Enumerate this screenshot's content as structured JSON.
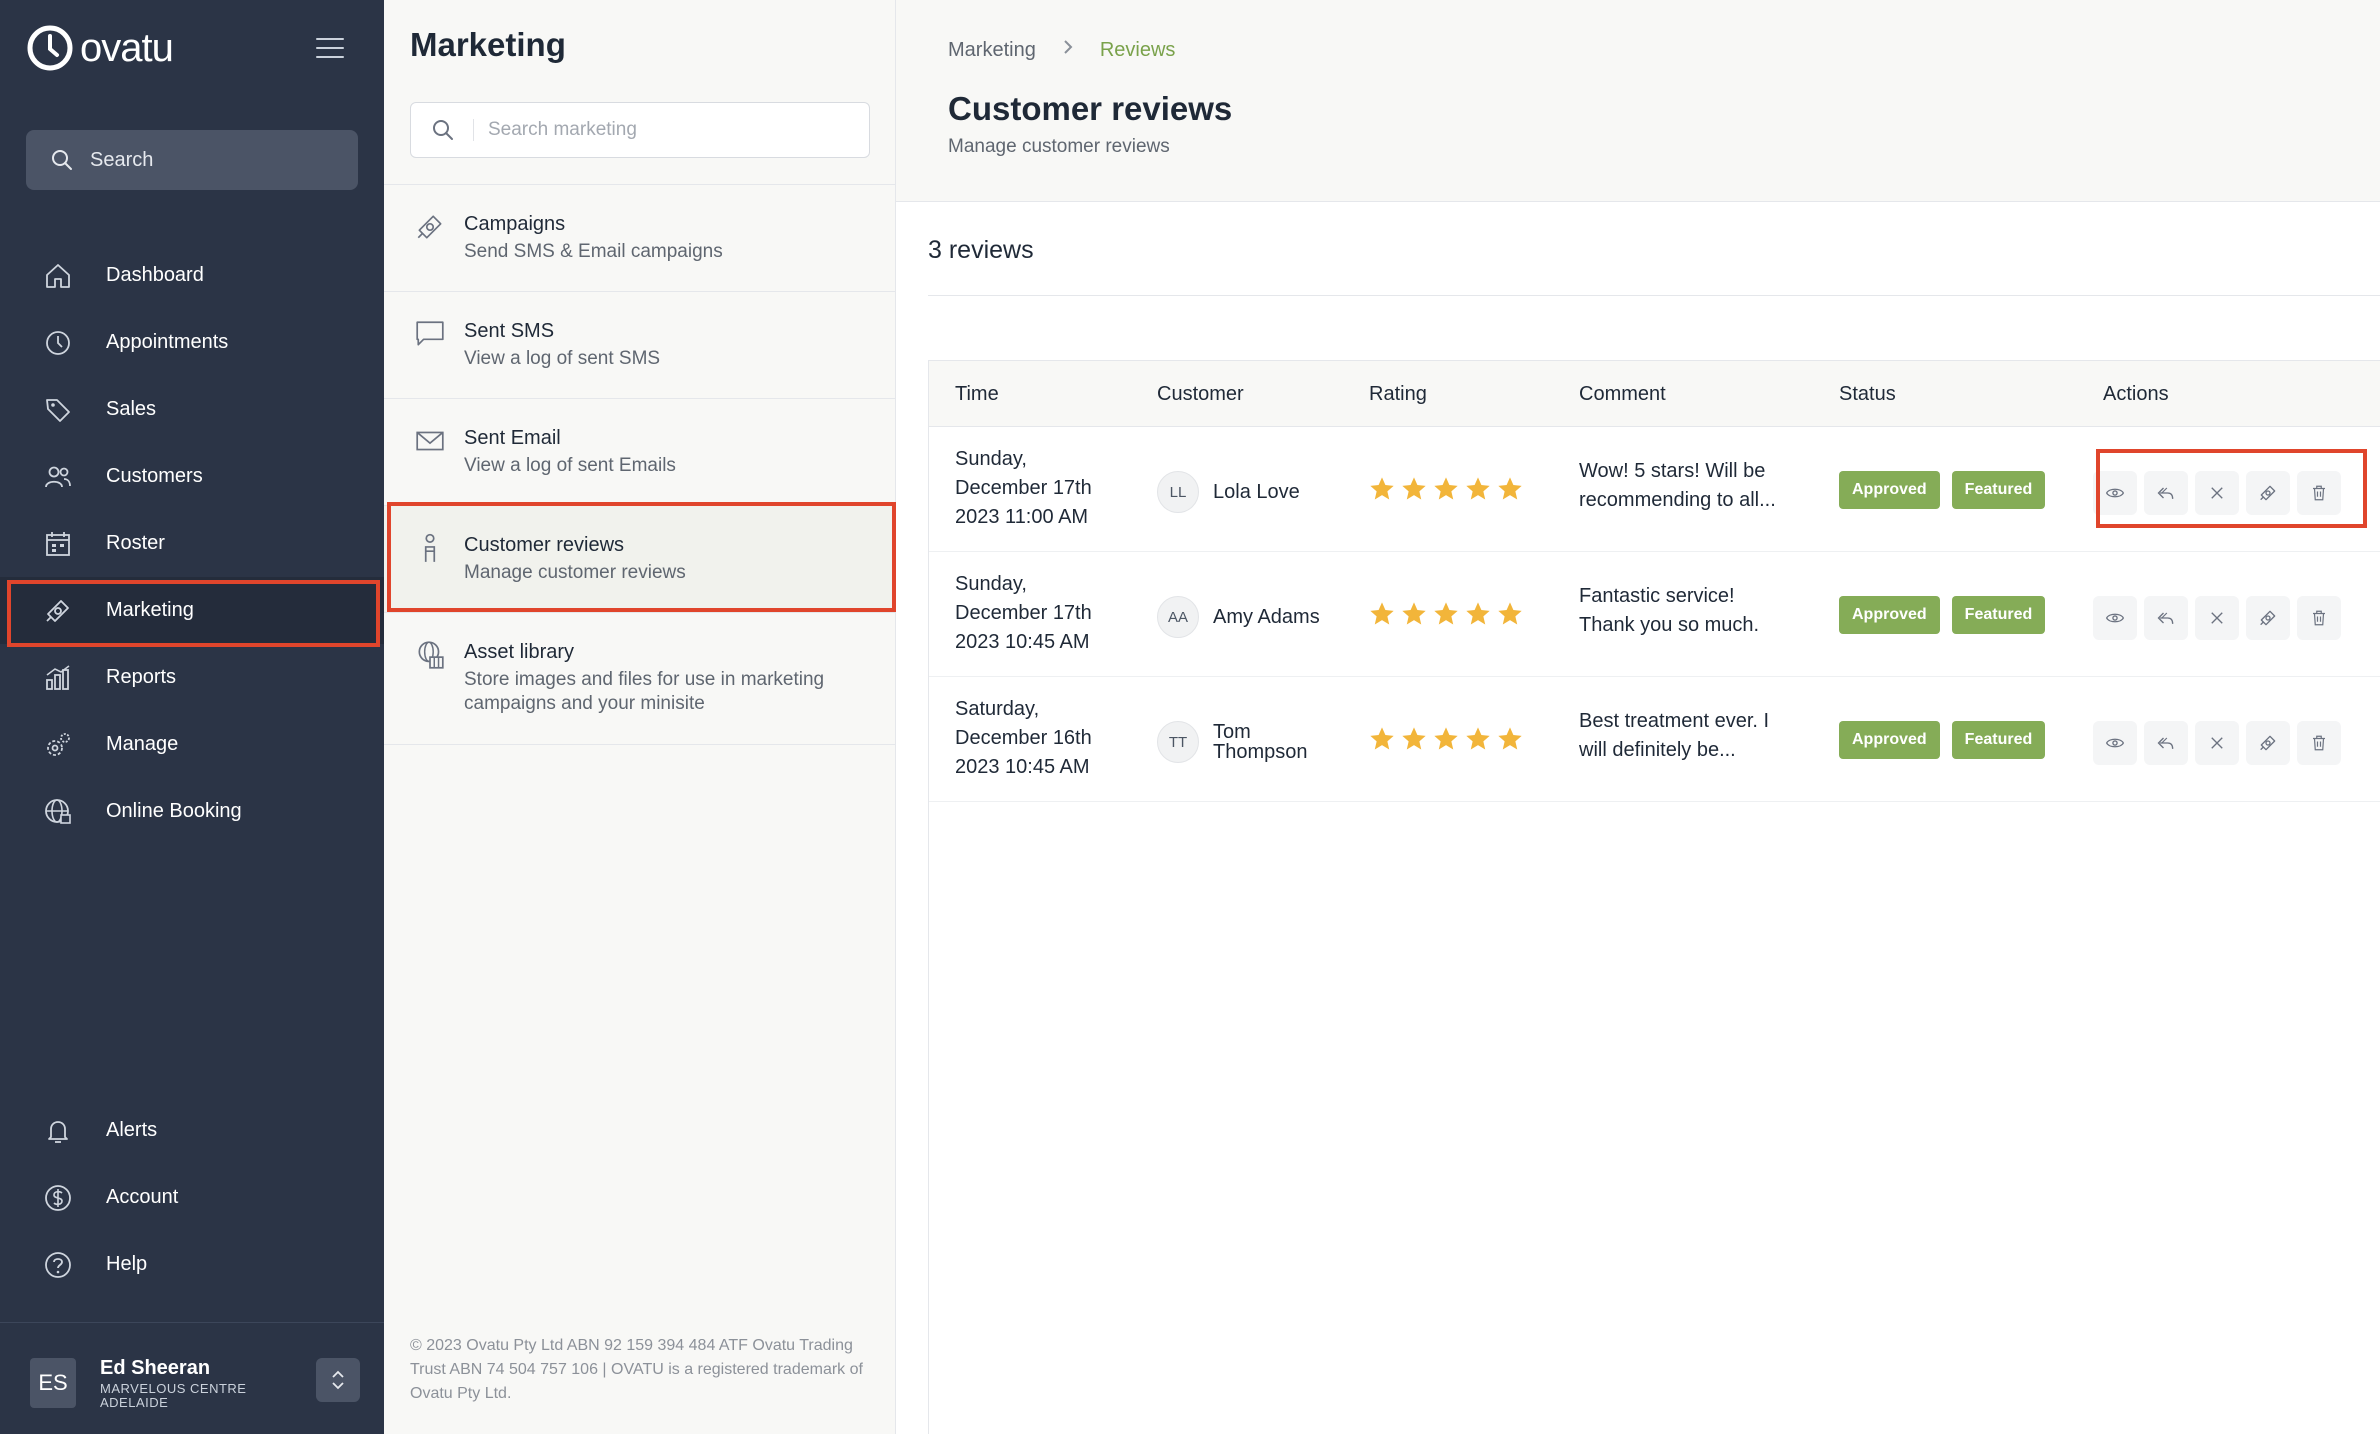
{
  "brand": {
    "name": "ovatu"
  },
  "sidebar": {
    "search_label": "Search",
    "nav": [
      {
        "label": "Dashboard",
        "icon": "home-icon"
      },
      {
        "label": "Appointments",
        "icon": "clock-icon"
      },
      {
        "label": "Sales",
        "icon": "tag-icon"
      },
      {
        "label": "Customers",
        "icon": "users-icon"
      },
      {
        "label": "Roster",
        "icon": "calendar-icon"
      },
      {
        "label": "Marketing",
        "icon": "megaphone-icon",
        "active": true
      },
      {
        "label": "Reports",
        "icon": "chart-icon"
      },
      {
        "label": "Manage",
        "icon": "gears-icon"
      },
      {
        "label": "Online Booking",
        "icon": "globe-icon"
      }
    ],
    "bottom_nav": [
      {
        "label": "Alerts",
        "icon": "bell-icon"
      },
      {
        "label": "Account",
        "icon": "dollar-icon"
      },
      {
        "label": "Help",
        "icon": "help-icon"
      }
    ],
    "profile": {
      "initials": "ES",
      "name": "Ed Sheeran",
      "location": "MARVELOUS CENTRE ADELAIDE"
    }
  },
  "marketing_panel": {
    "title": "Marketing",
    "search_placeholder": "Search marketing",
    "items": [
      {
        "title": "Campaigns",
        "subtitle": "Send SMS & Email campaigns",
        "icon": "megaphone-icon"
      },
      {
        "title": "Sent SMS",
        "subtitle": "View a log of sent SMS",
        "icon": "message-icon"
      },
      {
        "title": "Sent Email",
        "subtitle": "View a log of sent Emails",
        "icon": "envelope-icon"
      },
      {
        "title": "Customer reviews",
        "subtitle": "Manage customer reviews",
        "icon": "person-icon",
        "active": true
      },
      {
        "title": "Asset library",
        "subtitle": "Store images and files for use in marketing campaigns and your minisite",
        "icon": "library-icon"
      }
    ],
    "footer": "© 2023 Ovatu Pty Ltd ABN 92 159 394 484 ATF Ovatu Trading Trust ABN 74 504 757 106 | OVATU is a registered trademark of Ovatu Pty Ltd."
  },
  "main": {
    "breadcrumb": [
      "Marketing",
      "Reviews"
    ],
    "title": "Customer reviews",
    "subtitle": "Manage customer reviews",
    "count_label": "3 reviews",
    "columns": [
      "Time",
      "Customer",
      "Rating",
      "Comment",
      "Status",
      "Actions"
    ],
    "rows": [
      {
        "time": [
          "Sunday,",
          "December 17th",
          "2023 11:00 AM"
        ],
        "initials": "LL",
        "customer": "Lola Love",
        "rating": 5,
        "comment": [
          "Wow! 5 stars! Will be",
          "recommending to all..."
        ],
        "statuses": [
          "Approved",
          "Featured"
        ]
      },
      {
        "time": [
          "Sunday,",
          "December 17th",
          "2023 10:45 AM"
        ],
        "initials": "AA",
        "customer": "Amy Adams",
        "rating": 5,
        "comment": [
          "Fantastic service!",
          "Thank you so much."
        ],
        "statuses": [
          "Approved",
          "Featured"
        ]
      },
      {
        "time": [
          "Saturday,",
          "December 16th",
          "2023 10:45 AM"
        ],
        "initials": "TT",
        "customer": "Tom Thompson",
        "rating": 5,
        "comment": [
          "Best treatment ever. I",
          "will definitely be..."
        ],
        "statuses": [
          "Approved",
          "Featured"
        ]
      }
    ],
    "action_icons": [
      "eye-icon",
      "reply-icon",
      "close-icon",
      "megaphone-icon",
      "trash-icon"
    ]
  },
  "colors": {
    "sidebar_bg": "#2b3446",
    "accent_green": "#85ac57",
    "highlight_red": "#e0452c",
    "star": "#f2b53a"
  }
}
